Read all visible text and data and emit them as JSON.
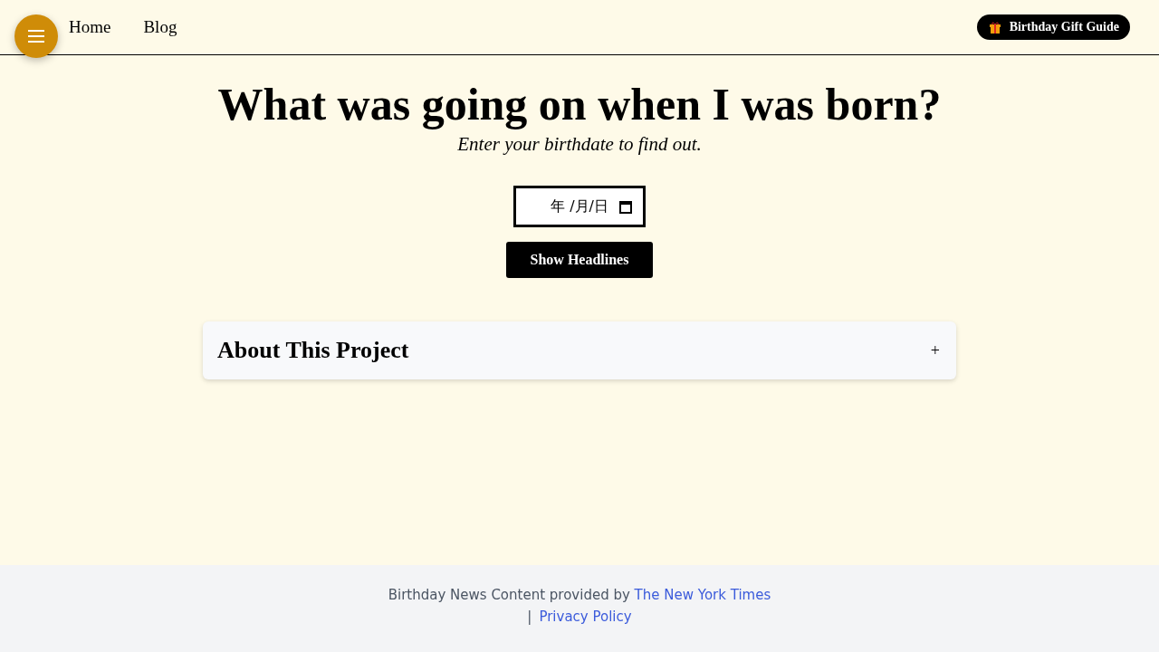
{
  "header": {
    "nav": [
      "Home",
      "Blog"
    ],
    "gift_button": "Birthday Gift Guide"
  },
  "hero": {
    "title": "What was going on when I was born?",
    "subtitle": "Enter your birthdate to find out.",
    "date_field": {
      "placeholder": "年 /月/日"
    },
    "submit_button": "Show Headlines"
  },
  "about": {
    "title": "About This Project",
    "toggle": "+"
  },
  "footer": {
    "credit": "Birthday News Content provided by ",
    "credit_link": "The New York Times",
    "separator": "|",
    "privacy_link": "Privacy Policy"
  }
}
